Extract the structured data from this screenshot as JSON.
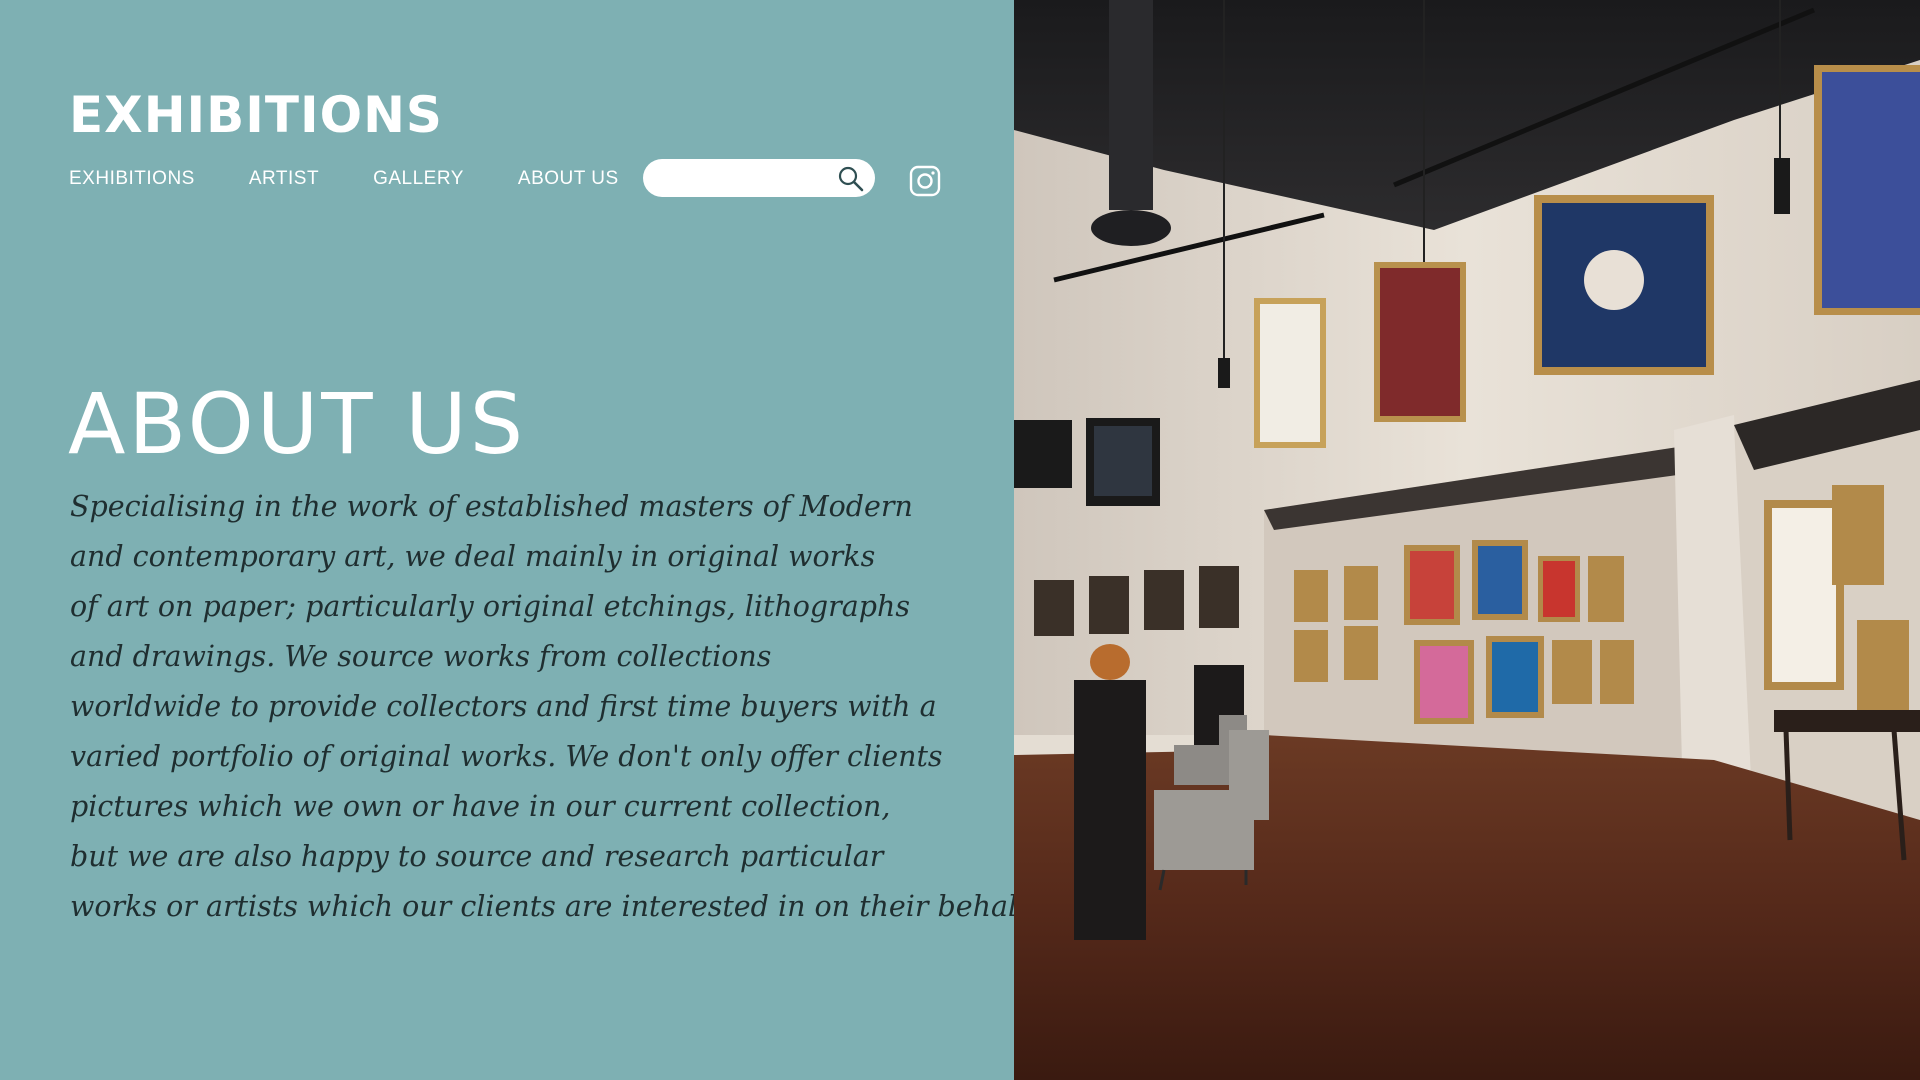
{
  "brand": {
    "title": "EXHIBITIONS"
  },
  "nav": {
    "items": [
      {
        "label": "EXHIBITIONS"
      },
      {
        "label": "ARTIST"
      },
      {
        "label": "GALLERY"
      },
      {
        "label": "ABOUT US"
      }
    ]
  },
  "search": {
    "value": "",
    "placeholder": "",
    "icon": "search-icon"
  },
  "social": {
    "icon": "instagram-icon"
  },
  "about": {
    "heading": "ABOUT US",
    "lines": [
      "Specialising in the work of established masters of Modern",
      "and contemporary art, we deal mainly in original works",
      "of art on paper; particularly original etchings, lithographs",
      "and drawings. We source works from collections",
      "worldwide to provide collectors and first time buyers with a",
      "varied portfolio of original works. We don't only offer clients",
      "pictures which we own or have in our current collection,",
      "but we are also happy to source and research particular",
      "works or artists which our clients are interested in on their behalf."
    ]
  },
  "colors": {
    "panel_background": "#7eb0b3",
    "heading_text": "#ffffff",
    "body_text": "#1f2e30"
  }
}
